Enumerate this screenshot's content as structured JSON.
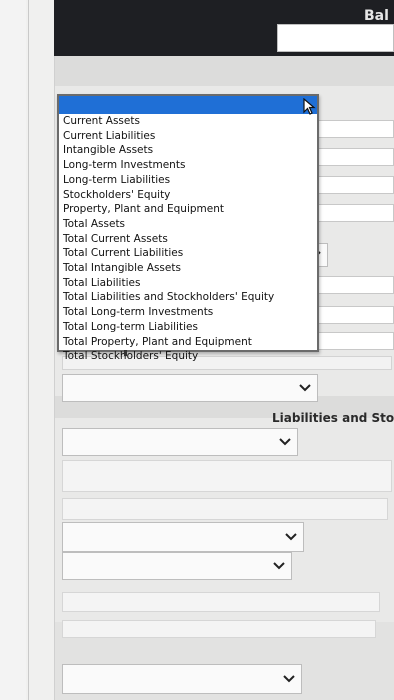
{
  "header": {
    "title": "Bal"
  },
  "dropdown": {
    "selected_value": "",
    "options": [
      "Current Assets",
      "Current Liabilities",
      "Intangible Assets",
      "Long-term Investments",
      "Long-term Liabilities",
      "Stockholders' Equity",
      "Property, Plant and Equipment",
      "Total Assets",
      "Total Current Assets",
      "Total Current Liabilities",
      "Total Intangible Assets",
      "Total Liabilities",
      "Total Liabilities and Stockholders' Equity",
      "Total Long-term Investments",
      "Total Long-term Liabilities",
      "Total Property, Plant and Equipment",
      "Total Stockholders' Equity"
    ]
  },
  "section": {
    "liabilities_label": "Liabilities and Stock"
  },
  "colors": {
    "header_bg": "#1e1f23",
    "selection": "#1f6fd6",
    "page_bg": "#e9e9e8"
  },
  "icons": {
    "dropdown_chevron": "chevron-down-icon",
    "pointer": "mouse-pointer-icon"
  }
}
